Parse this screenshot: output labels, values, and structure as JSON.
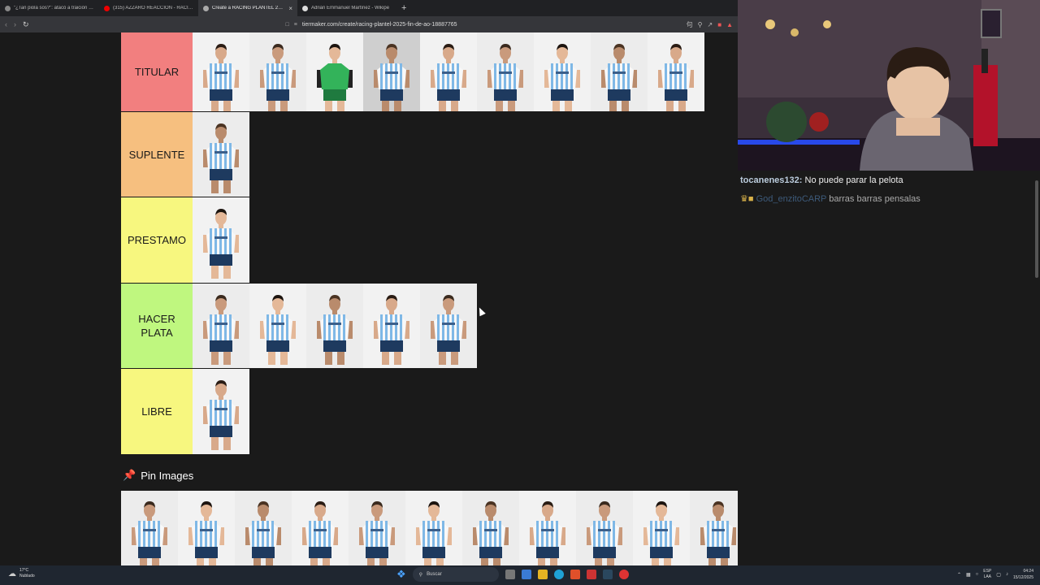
{
  "browser": {
    "tabs": [
      {
        "label": "\"¿Tan piola sos?\": atacó a traición a u",
        "fav": "#888",
        "active": false
      },
      {
        "label": "(315) AZZARO REACCIÓN - RACING",
        "fav": "#e00",
        "active": false
      },
      {
        "label": "Create a RACING PLANTEL 2025",
        "fav": "#aaa",
        "active": true
      },
      {
        "label": "Adrián Emmanuel Martínez - Wikipe",
        "fav": "#ddd",
        "active": false
      }
    ],
    "url": "tiermaker.com/create/racing-plantel-2025-fin-de-ao-18887765"
  },
  "tiers": [
    {
      "name": "TITULAR",
      "color": "#f27f7f",
      "count": 9,
      "gk_index": 2,
      "controls": false
    },
    {
      "name": "SUPLENTE",
      "color": "#f6bf7f",
      "count": 1,
      "gk_index": -1,
      "controls": false
    },
    {
      "name": "PRESTAMO",
      "color": "#f7f77f",
      "count": 1,
      "gk_index": -1,
      "controls": true
    },
    {
      "name": "HACER PLATA",
      "color": "#bff77f",
      "count": 5,
      "gk_index": -1,
      "controls": true
    },
    {
      "name": "LIBRE",
      "color": "#f7f77f",
      "count": 1,
      "gk_index": -1,
      "controls": true
    }
  ],
  "pin_images": {
    "title": "Pin Images",
    "count": 12,
    "gk_index": 11
  },
  "chat": [
    {
      "user": "tocanenes132:",
      "msg": "No puede parar la pelota",
      "dim": false
    },
    {
      "user": "God_enzitoCARP",
      "msg": "barras barras pensalas",
      "dim": true
    }
  ],
  "taskbar": {
    "weather_temp": "17°C",
    "weather_desc": "Nublado",
    "search_placeholder": "Buscar",
    "lang_1": "ESP",
    "lang_2": "LAA",
    "time": "04:24",
    "date": "15/12/2025"
  },
  "colors": {
    "kit_stripe": "#7fb8e6",
    "kit_white": "#f8f8f8",
    "gk_green": "#33b35a",
    "shorts": "#1e3a5f"
  }
}
